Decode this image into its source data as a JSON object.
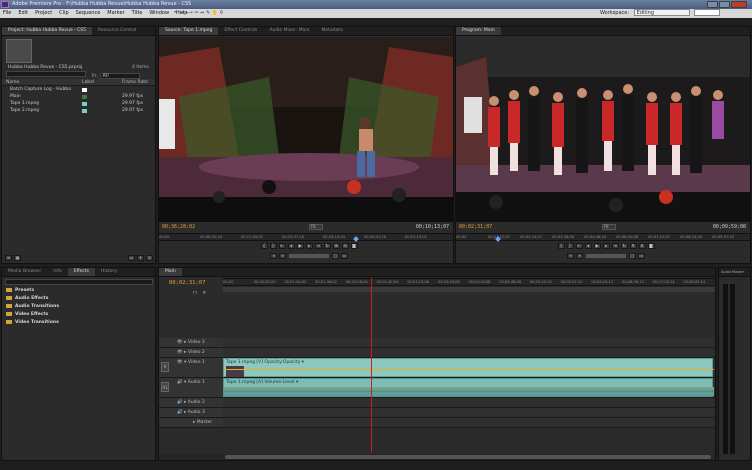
{
  "window": {
    "title": "Adobe Premiere Pro - F:\\Hubba Hubba Revue\\Hubba Hubba Revue - CS5"
  },
  "menu": [
    "File",
    "Edit",
    "Project",
    "Clip",
    "Sequence",
    "Marker",
    "Title",
    "Window",
    "Help"
  ],
  "workspace": {
    "label": "Workspace:",
    "value": "Editing"
  },
  "project_panel": {
    "tabs": [
      "Project: Hubba Hubba Revue - CS5",
      "Resource Central"
    ],
    "project_file": "Hubba Hubba Revue - CS5.prproj",
    "item_count": "4 Items",
    "in_label": "In:",
    "in_value": "All",
    "columns": [
      "Name",
      "Label",
      "Frame Rate"
    ],
    "items": [
      {
        "name": "Batch Capture Log - Hubba",
        "rate": ""
      },
      {
        "name": "Main",
        "rate": "29.97 fps"
      },
      {
        "name": "Tape 1.mpeg",
        "rate": "29.97 fps"
      },
      {
        "name": "Tape 2.mpeg",
        "rate": "29.97 fps"
      }
    ],
    "label_colors": [
      "#ffffff",
      "#3d7a3d",
      "#7ccfc0",
      "#7ccfc0"
    ]
  },
  "source_monitor": {
    "tabs": [
      "Source: Tape 1.mpeg",
      "Effect Controls",
      "Audio Mixer: Main",
      "Metadata"
    ],
    "timecode_in": "00;36;28;02",
    "timecode_dur": "00;10;13;07",
    "fit": "Fit",
    "ruler": [
      "00;00",
      "00;08;32;16",
      "00;17;05;02",
      "00;25;37;18",
      "00;34;10;04",
      "00;42;41;16",
      "00;51;15;02"
    ]
  },
  "program_monitor": {
    "tabs": [
      "Program: Main"
    ],
    "timecode_in": "00;02;31;07",
    "timecode_dur": "00;09;59;08",
    "fit": "Fit",
    "ruler": [
      "00;00",
      "00;01;12;02",
      "00;02;24;12",
      "00;03;36;06",
      "00;04;48;18",
      "00;06;00;08",
      "00;07;12;22",
      "00;08;24;28",
      "00;09;37;10"
    ]
  },
  "effects_panel": {
    "tabs": [
      "Media Browser",
      "Info",
      "Effects",
      "History"
    ],
    "folders": [
      "Presets",
      "Audio Effects",
      "Audio Transitions",
      "Video Effects",
      "Video Transitions"
    ]
  },
  "timeline": {
    "tab": "Main",
    "timecode": "00;02;31;07",
    "ruler": [
      "00;00",
      "00;00;32;00",
      "00;01;04;02",
      "00;01;36;02",
      "00;02;08;04",
      "00;02;40;04",
      "00;03;12;06",
      "00;03;44;06",
      "00;04;16;08",
      "00;04;48;08",
      "00;05;20;10",
      "00;05;52;10",
      "00;06;24;12",
      "00;06;56;12",
      "00;07;28;14",
      "00;08;00;14"
    ],
    "video_tracks": [
      "Video 3",
      "Video 2",
      "Video 1"
    ],
    "audio_tracks": [
      "Audio 1",
      "Audio 2",
      "Audio 3",
      "Master"
    ],
    "v_label": "V",
    "a_label": "A1",
    "video_clip": "Tape 1.mpeg [V]  Opacity:Opacity ▾",
    "audio_clip": "Tape 1.mpeg [A]  Volume:Level ▾",
    "playhead_fraction": 0.3
  },
  "audio_master": {
    "title": "Audio Master"
  },
  "icons": [
    "app-icon",
    "minimize-icon",
    "maximize-icon",
    "close-icon",
    "play-icon",
    "step-back-icon",
    "step-forward-icon",
    "loop-icon",
    "camera-icon",
    "folder-icon",
    "magnet-icon"
  ],
  "colors": {
    "timecode": "#e8a13a",
    "clip": "#8cc7c0",
    "playhead": "#c82020",
    "folder": "#d5a23c"
  }
}
